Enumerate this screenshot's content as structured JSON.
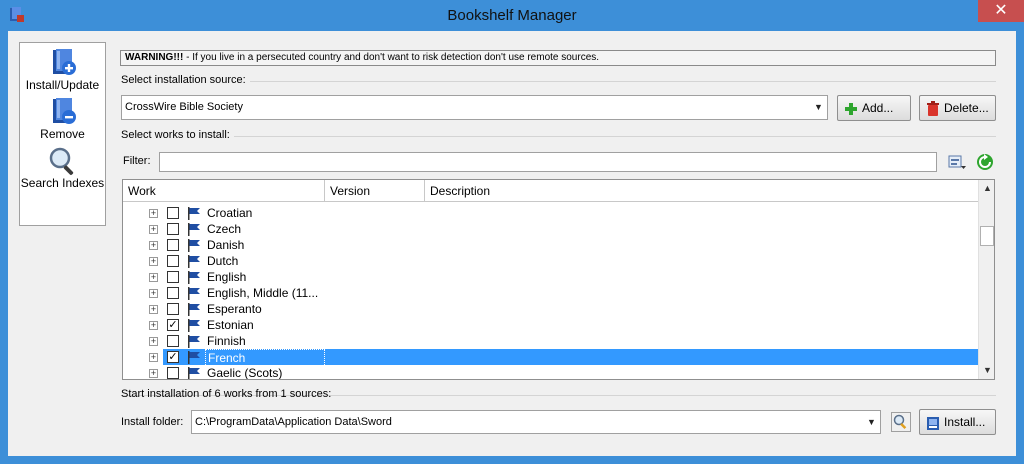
{
  "window": {
    "title": "Bookshelf Manager",
    "close_symbol": "✕",
    "accent_color": "#3d8fd8"
  },
  "sidebar": {
    "items": [
      {
        "label": "Install/Update",
        "icon": "book-plus-icon"
      },
      {
        "label": "Remove",
        "icon": "book-minus-icon"
      },
      {
        "label": "Search Indexes",
        "icon": "magnifier-icon"
      }
    ]
  },
  "warning": {
    "strong": "WARNING!!!",
    "text": " -  If you live in a persecuted country and don't want to risk detection don't use remote sources."
  },
  "source": {
    "group_label": "Select installation source:",
    "selected": "CrossWire Bible Society",
    "add_label": "Add...",
    "delete_label": "Delete..."
  },
  "works": {
    "group_label": "Select works to install:",
    "filter_label": "Filter:",
    "filter_value": "",
    "columns": [
      "Work",
      "Version",
      "Description"
    ],
    "rows": [
      {
        "label": "Croatian",
        "checked": false,
        "selected": false
      },
      {
        "label": "Czech",
        "checked": false,
        "selected": false
      },
      {
        "label": "Danish",
        "checked": false,
        "selected": false
      },
      {
        "label": "Dutch",
        "checked": false,
        "selected": false
      },
      {
        "label": "English",
        "checked": false,
        "selected": false
      },
      {
        "label": "English, Middle (11...",
        "checked": false,
        "selected": false
      },
      {
        "label": "Esperanto",
        "checked": false,
        "selected": false
      },
      {
        "label": "Estonian",
        "checked": true,
        "selected": false
      },
      {
        "label": "Finnish",
        "checked": false,
        "selected": false
      },
      {
        "label": "French",
        "checked": true,
        "selected": true
      },
      {
        "label": "Gaelic (Scots)",
        "checked": false,
        "selected": false
      }
    ]
  },
  "status_text": "Start installation of 6 works from 1 sources:",
  "install": {
    "folder_label": "Install folder:",
    "folder_value": "C:\\ProgramData\\Application Data\\Sword",
    "install_label": "Install..."
  }
}
